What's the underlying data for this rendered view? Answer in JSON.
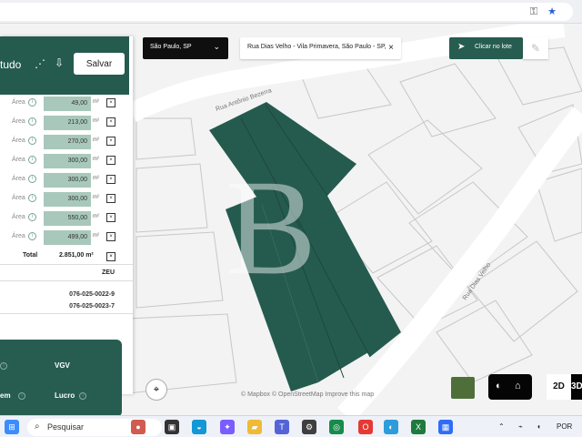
{
  "browser": {
    "address": "",
    "icons": [
      "key-icon",
      "star-icon"
    ]
  },
  "panel": {
    "title": "tudo",
    "save_label": "Salvar",
    "rows": [
      {
        "label": "Área",
        "value": "49,00",
        "unit": "m²"
      },
      {
        "label": "Área",
        "value": "213,00",
        "unit": "m²"
      },
      {
        "label": "Área",
        "value": "270,00",
        "unit": "m²"
      },
      {
        "label": "Área",
        "value": "300,00",
        "unit": "m²"
      },
      {
        "label": "Área",
        "value": "300,00",
        "unit": "m²"
      },
      {
        "label": "Área",
        "value": "300,00",
        "unit": "m²"
      },
      {
        "label": "Área",
        "value": "550,00",
        "unit": "m²"
      },
      {
        "label": "Área",
        "value": "499,00",
        "unit": "m²"
      }
    ],
    "total_label": "Total",
    "total_value": "2.851,00 m²",
    "zone": "ZEU",
    "lot_codes": [
      "076-025-0022-9",
      "076-025-0023-7"
    ],
    "metrics": {
      "vgv": "VGV",
      "left_bottom": "em",
      "profit": "Lucro"
    }
  },
  "map": {
    "city": "São Paulo, SP",
    "search": "Rua Dias Velho - Vila Primavera, São Paulo - SP,",
    "click_lot": "Clicar no lote",
    "street_1": "Rua Antônio Bezerra",
    "street_2": "Rua Dias Velho",
    "credit": "© Mapbox © OpenStreetMap Improve this map",
    "view_2d": "2D",
    "view_3d": "3D"
  },
  "taskbar": {
    "search_placeholder": "Pesquisar",
    "language": "POR"
  },
  "colors": {
    "accent": "#265d50",
    "lot": "#255b4f",
    "soft_green": "#a8c8bb"
  }
}
